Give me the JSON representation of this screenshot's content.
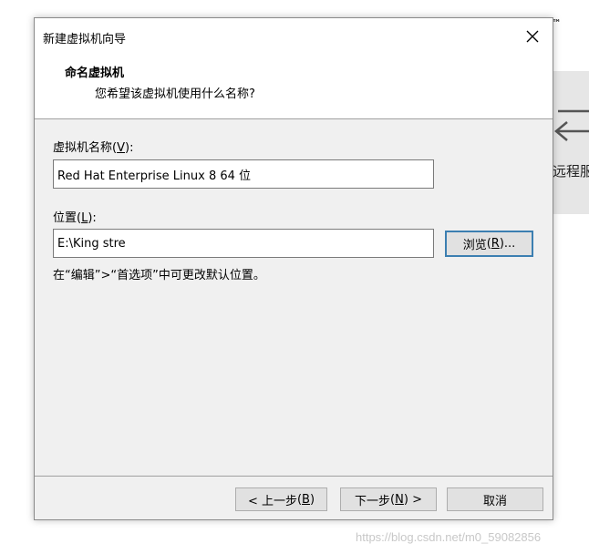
{
  "background_app": {
    "trademark": "™",
    "side_label": "远程服"
  },
  "dialog": {
    "title": "新建虚拟机向导",
    "header_title": "命名虚拟机",
    "header_subtitle": "您希望该虚拟机使用什么名称?",
    "vm_name_label": "虚拟机名称",
    "vm_name_mnemonic": "V",
    "vm_name_value": "Red Hat Enterprise Linux 8 64 位",
    "location_label": "位置",
    "location_mnemonic": "L",
    "location_value": "E:\\King stre",
    "browse_label": "浏览",
    "browse_mnemonic": "R",
    "hint": "在“编辑”>“首选项”中可更改默认位置。",
    "back_label": "< 上一步",
    "back_mnemonic": "B",
    "next_label": "下一步",
    "next_mnemonic": "N",
    "cancel_label": "取消"
  },
  "watermark": "https://blog.csdn.net/m0_59082856"
}
